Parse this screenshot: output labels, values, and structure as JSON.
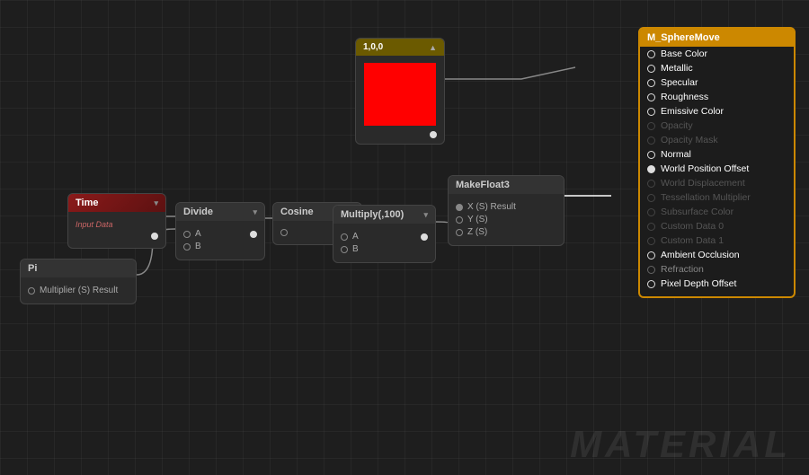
{
  "canvas": {
    "background": "#1e1e1e"
  },
  "nodes": {
    "time": {
      "title": "Time",
      "subtitle": "Input Data",
      "outputs": []
    },
    "pi": {
      "title": "Pi",
      "outputs": [
        {
          "label": "Multiplier (S) Result"
        }
      ]
    },
    "divide": {
      "title": "Divide",
      "chevron": "▾",
      "inputs": [
        {
          "label": "A"
        },
        {
          "label": "B"
        }
      ]
    },
    "cosine": {
      "title": "Cosine",
      "chevron": "▾",
      "inputs": [
        {
          "label": ""
        }
      ]
    },
    "multiply": {
      "title": "Multiply(,100)",
      "chevron": "▾",
      "inputs": [
        {
          "label": "A"
        },
        {
          "label": "B"
        }
      ]
    },
    "makefloat": {
      "title": "MakeFloat3",
      "outputs": [
        {
          "label": "X (S) Result"
        },
        {
          "label": "Y (S)"
        },
        {
          "label": "Z (S)"
        }
      ]
    },
    "color": {
      "title": "1,0,0",
      "swatch_color": "#ff0000"
    }
  },
  "material_panel": {
    "title": "M_SphereMove",
    "items": [
      {
        "label": "Base Color",
        "state": "active"
      },
      {
        "label": "Metallic",
        "state": "active"
      },
      {
        "label": "Specular",
        "state": "active"
      },
      {
        "label": "Roughness",
        "state": "active"
      },
      {
        "label": "Emissive Color",
        "state": "active"
      },
      {
        "label": "Opacity",
        "state": "dim"
      },
      {
        "label": "Opacity Mask",
        "state": "dim"
      },
      {
        "label": "Normal",
        "state": "active"
      },
      {
        "label": "World Position Offset",
        "state": "active_filled"
      },
      {
        "label": "World Displacement",
        "state": "dim"
      },
      {
        "label": "Tessellation Multiplier",
        "state": "dim"
      },
      {
        "label": "Subsurface Color",
        "state": "dim"
      },
      {
        "label": "Custom Data 0",
        "state": "dim"
      },
      {
        "label": "Custom Data 1",
        "state": "dim"
      },
      {
        "label": "Ambient Occlusion",
        "state": "active"
      },
      {
        "label": "Refraction",
        "state": "normal"
      },
      {
        "label": "Pixel Depth Offset",
        "state": "active"
      }
    ]
  },
  "watermark": {
    "text": "MATERIAL"
  }
}
